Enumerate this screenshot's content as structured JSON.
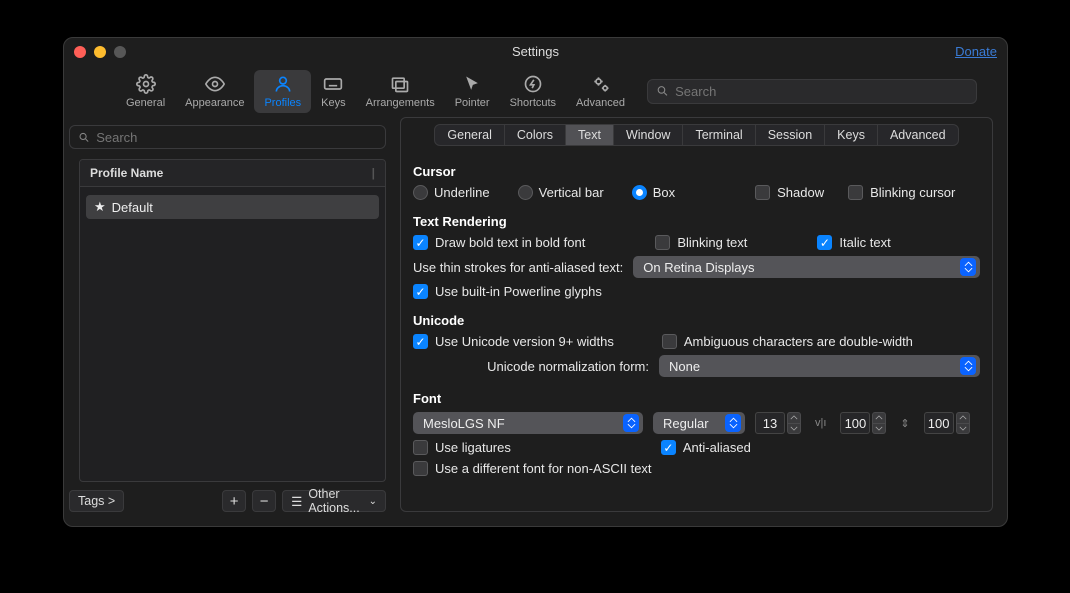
{
  "window": {
    "title": "Settings",
    "donate": "Donate"
  },
  "toolbar": {
    "items": [
      {
        "label": "General"
      },
      {
        "label": "Appearance"
      },
      {
        "label": "Profiles"
      },
      {
        "label": "Keys"
      },
      {
        "label": "Arrangements"
      },
      {
        "label": "Pointer"
      },
      {
        "label": "Shortcuts"
      },
      {
        "label": "Advanced"
      }
    ],
    "search_placeholder": "Search"
  },
  "sidebar": {
    "search_placeholder": "Search",
    "header": "Profile Name",
    "profile_name": "Default",
    "tags_button": "Tags >",
    "other_actions": "Other Actions..."
  },
  "tabs": [
    "General",
    "Colors",
    "Text",
    "Window",
    "Terminal",
    "Session",
    "Keys",
    "Advanced"
  ],
  "selected_tab": "Text",
  "cursor": {
    "title": "Cursor",
    "underline": "Underline",
    "vertical": "Vertical bar",
    "box": "Box",
    "shadow": "Shadow",
    "blinking": "Blinking cursor"
  },
  "text_rendering": {
    "title": "Text Rendering",
    "bold": "Draw bold text in bold font",
    "blinking": "Blinking text",
    "italic": "Italic text",
    "thin_label": "Use thin strokes for anti-aliased text:",
    "thin_value": "On Retina Displays",
    "powerline": "Use built-in Powerline glyphs"
  },
  "unicode": {
    "title": "Unicode",
    "v9": "Use Unicode version 9+ widths",
    "ambiguous": "Ambiguous characters are double-width",
    "norm_label": "Unicode normalization form:",
    "norm_value": "None"
  },
  "font": {
    "title": "Font",
    "family": "MesloLGS NF",
    "weight": "Regular",
    "size": "13",
    "hspace": "100",
    "vspace": "100",
    "ligatures": "Use ligatures",
    "antialiased": "Anti-aliased",
    "nonascii": "Use a different font for non-ASCII text"
  }
}
